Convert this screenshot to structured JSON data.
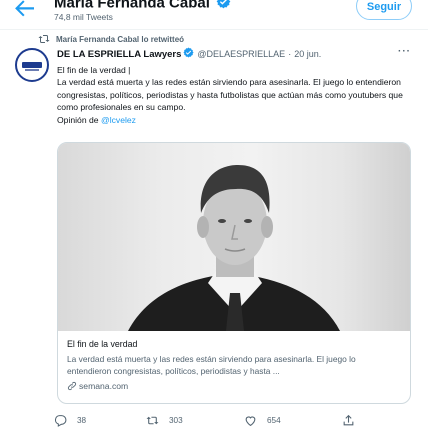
{
  "header": {
    "profile_name": "María Fernanda Cabal",
    "tweet_count": "74,8 mil Tweets",
    "follow_label": "Seguir"
  },
  "retweet_notice": "María Fernanda Cabal lo retwitteó",
  "tweet": {
    "author_name": "DE LA ESPRIELLA Lawyers",
    "author_handle": "@DELAESPRIELLAE",
    "separator": "·",
    "date": "20 jun.",
    "more_label": "···",
    "line1": "El fin de la verdad |",
    "body": "La verdad está muerta y las redes están sirviendo para asesinarla. El juego lo entendieron congresistas, políticos, periodistas y hasta futbolistas que actúan más como youtubers que como profesionales en su campo.",
    "opinion_prefix": "Opinión de ",
    "mention": "@lcvelez"
  },
  "card": {
    "title": "El fin de la verdad",
    "description": "La verdad está muerta y las redes están sirviendo para asesinarla. El juego lo entendieron congresistas, políticos, periodistas y hasta ...",
    "domain": "semana.com"
  },
  "actions": {
    "replies": "38",
    "retweets": "303",
    "likes": "654"
  },
  "icons": {
    "back": "arrow-left-icon",
    "verified": "verified-badge-icon",
    "retweet": "retweet-icon",
    "more": "more-icon",
    "link": "link-icon",
    "reply": "reply-icon",
    "like": "heart-icon",
    "share": "share-icon"
  },
  "colors": {
    "accent": "#1d9bf0",
    "text": "#0f1419",
    "secondary": "#536471",
    "border": "#cfd9de"
  }
}
